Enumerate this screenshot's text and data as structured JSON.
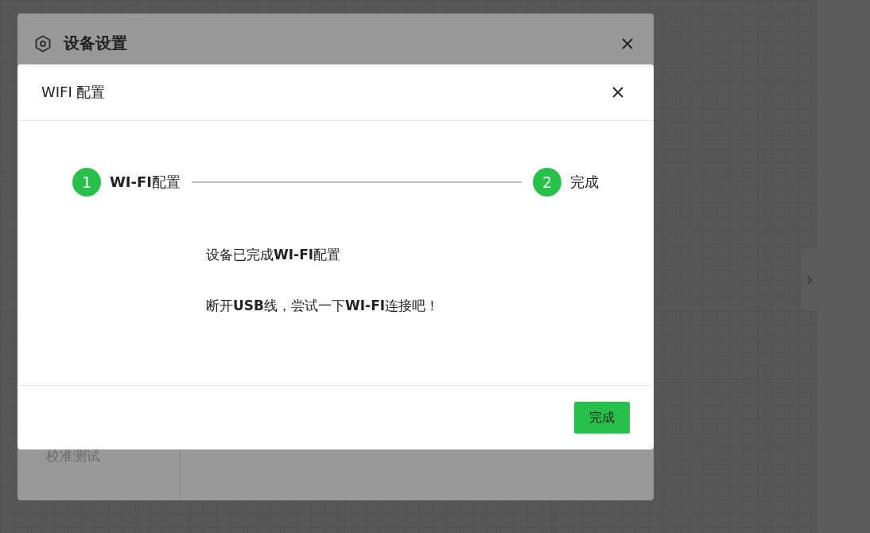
{
  "settings_dialog": {
    "title": "设备设置",
    "sidebar_items": [
      {
        "label": "校准测试"
      }
    ]
  },
  "wifi_dialog": {
    "title": "WIFI 配置",
    "steps": [
      {
        "number": "1",
        "label": "**WI-FI**配置",
        "completed": true
      },
      {
        "number": "2",
        "label": "完成",
        "completed": true
      }
    ],
    "messages": [
      "设备已完成**WI-FI**配置",
      "断开**USB**线，尝试一下**WI-FI**连接吧！"
    ],
    "buttons": [
      {
        "label": "完成"
      }
    ]
  }
}
